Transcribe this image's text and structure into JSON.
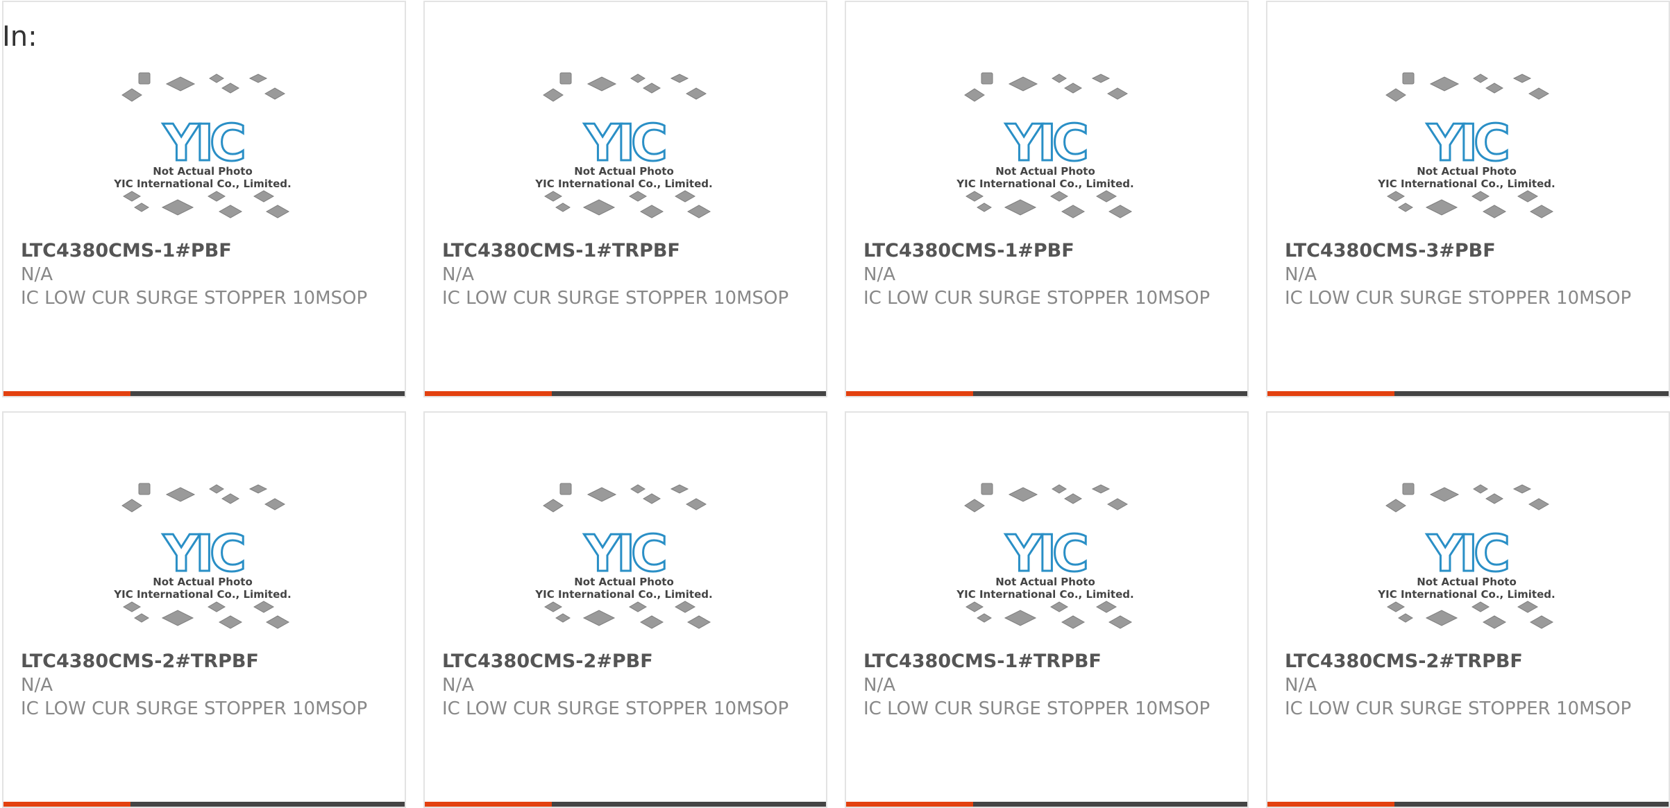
{
  "page": {
    "label": "In:"
  },
  "thumbnail": {
    "logo_text": "YIC",
    "caption_line1": "Not Actual Photo",
    "caption_line2": "YIC International Co., Limited."
  },
  "colors": {
    "accent": "#e3410f",
    "bar": "#444444",
    "logo": "#2a8fc6",
    "border": "#e3e3e3"
  },
  "products": [
    {
      "part_number": "LTC4380CMS-1#PBF",
      "manufacturer": "N/A",
      "description": "IC LOW CUR SURGE STOPPER 10MSOP"
    },
    {
      "part_number": "LTC4380CMS-1#TRPBF",
      "manufacturer": "N/A",
      "description": "IC LOW CUR SURGE STOPPER 10MSOP"
    },
    {
      "part_number": "LTC4380CMS-1#PBF",
      "manufacturer": "N/A",
      "description": "IC LOW CUR SURGE STOPPER 10MSOP"
    },
    {
      "part_number": "LTC4380CMS-3#PBF",
      "manufacturer": "N/A",
      "description": "IC LOW CUR SURGE STOPPER 10MSOP"
    },
    {
      "part_number": "LTC4380CMS-2#TRPBF",
      "manufacturer": "N/A",
      "description": "IC LOW CUR SURGE STOPPER 10MSOP"
    },
    {
      "part_number": "LTC4380CMS-2#PBF",
      "manufacturer": "N/A",
      "description": "IC LOW CUR SURGE STOPPER 10MSOP"
    },
    {
      "part_number": "LTC4380CMS-1#TRPBF",
      "manufacturer": "N/A",
      "description": "IC LOW CUR SURGE STOPPER 10MSOP"
    },
    {
      "part_number": "LTC4380CMS-2#TRPBF",
      "manufacturer": "N/A",
      "description": "IC LOW CUR SURGE STOPPER 10MSOP"
    }
  ]
}
